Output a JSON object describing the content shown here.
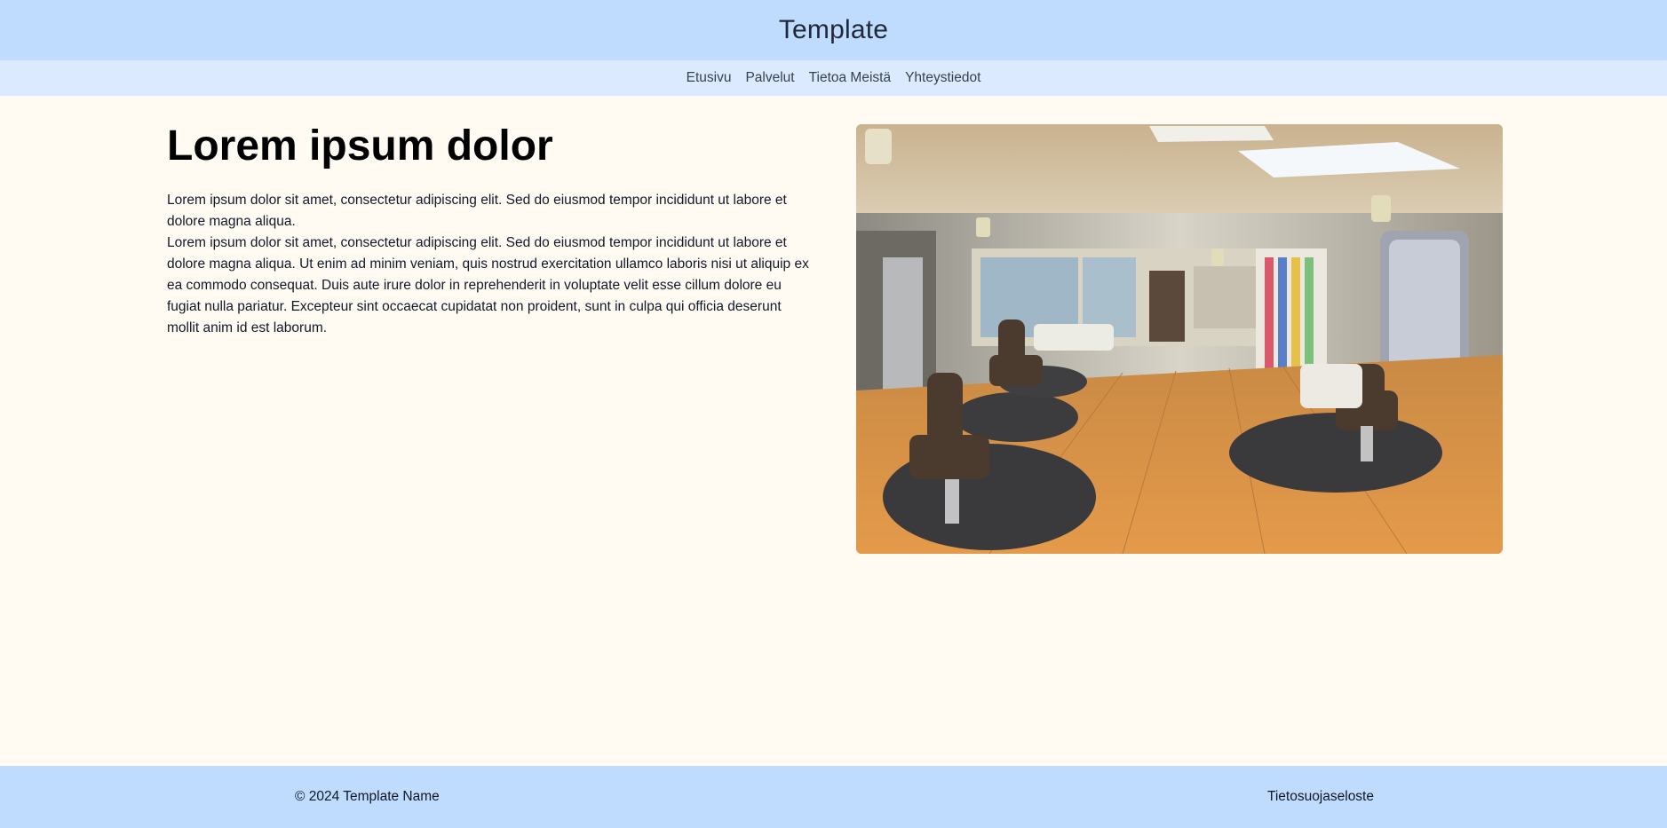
{
  "header": {
    "title": "Template"
  },
  "nav": {
    "items": [
      {
        "label": "Etusivu"
      },
      {
        "label": "Palvelut"
      },
      {
        "label": "Tietoa Meistä"
      },
      {
        "label": "Yhteystiedot"
      }
    ]
  },
  "main": {
    "headline": "Lorem ipsum dolor",
    "paragraph_1": "Lorem ipsum dolor sit amet, consectetur adipiscing elit. Sed do eiusmod tempor incididunt ut labore et dolore magna aliqua.",
    "paragraph_2": "Lorem ipsum dolor sit amet, consectetur adipiscing elit. Sed do eiusmod tempor incididunt ut labore et dolore magna aliqua. Ut enim ad minim veniam, quis nostrud exercitation ullamco laboris nisi ut aliquip ex ea commodo consequat. Duis aute irure dolor in reprehenderit in voluptate velit esse cillum dolore eu fugiat nulla pariatur. Excepteur sint occaecat cupidatat non proident, sunt in culpa qui officia deserunt mollit anim id est laborum.",
    "image_icon": "salon-photo"
  },
  "footer": {
    "copyright": "© 2024 Template Name",
    "privacy_link": "Tietosuojaseloste"
  },
  "colors": {
    "header_bg": "#bfdbfe",
    "nav_bg": "#dbeafe",
    "page_bg": "#fffbf3",
    "footer_bg": "#bfdbfe"
  }
}
